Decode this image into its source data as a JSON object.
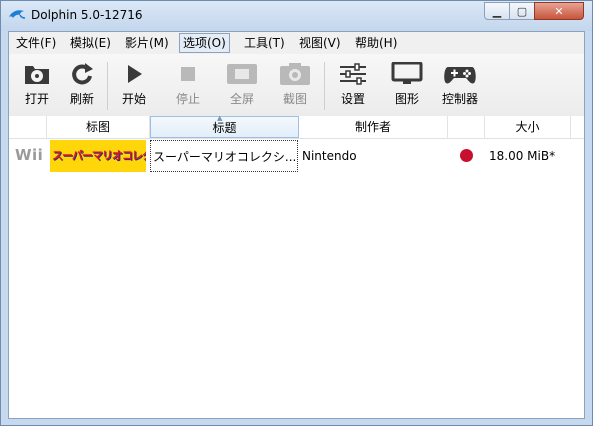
{
  "window": {
    "title": "Dolphin 5.0-12716",
    "controls": {
      "minimize": "▁",
      "maximize": "▢",
      "close": "✕"
    }
  },
  "menu": {
    "items": [
      {
        "label": "文件(F)"
      },
      {
        "label": "模拟(E)"
      },
      {
        "label": "影片(M)"
      },
      {
        "label": "选项(O)",
        "active": true
      },
      {
        "label": "工具(T)"
      },
      {
        "label": "视图(V)"
      },
      {
        "label": "帮助(H)"
      }
    ]
  },
  "toolbar": {
    "open": {
      "label": "打开",
      "icon": "open-disc-icon",
      "enabled": true
    },
    "refresh": {
      "label": "刷新",
      "icon": "refresh-icon",
      "enabled": true
    },
    "play": {
      "label": "开始",
      "icon": "play-icon",
      "enabled": true
    },
    "stop": {
      "label": "停止",
      "icon": "stop-icon",
      "enabled": false
    },
    "fullscreen": {
      "label": "全屏",
      "icon": "fullscreen-icon",
      "enabled": false
    },
    "screenshot": {
      "label": "截图",
      "icon": "camera-icon",
      "enabled": false
    },
    "config": {
      "label": "设置",
      "icon": "sliders-icon",
      "enabled": true
    },
    "graphics": {
      "label": "图形",
      "icon": "monitor-icon",
      "enabled": true
    },
    "controllers": {
      "label": "控制器",
      "icon": "gamepad-icon",
      "enabled": true
    }
  },
  "columns": {
    "banner": "标图",
    "title": "标题",
    "maker": "制作者",
    "size": "大小"
  },
  "games": [
    {
      "platform": "Wii",
      "banner_text": "スーパーマリオコレクション!",
      "title": "スーパーマリオコレクシ...",
      "maker": "Nintendo",
      "region_color": "#c8102e",
      "size": "18.00 MiB*"
    }
  ]
}
